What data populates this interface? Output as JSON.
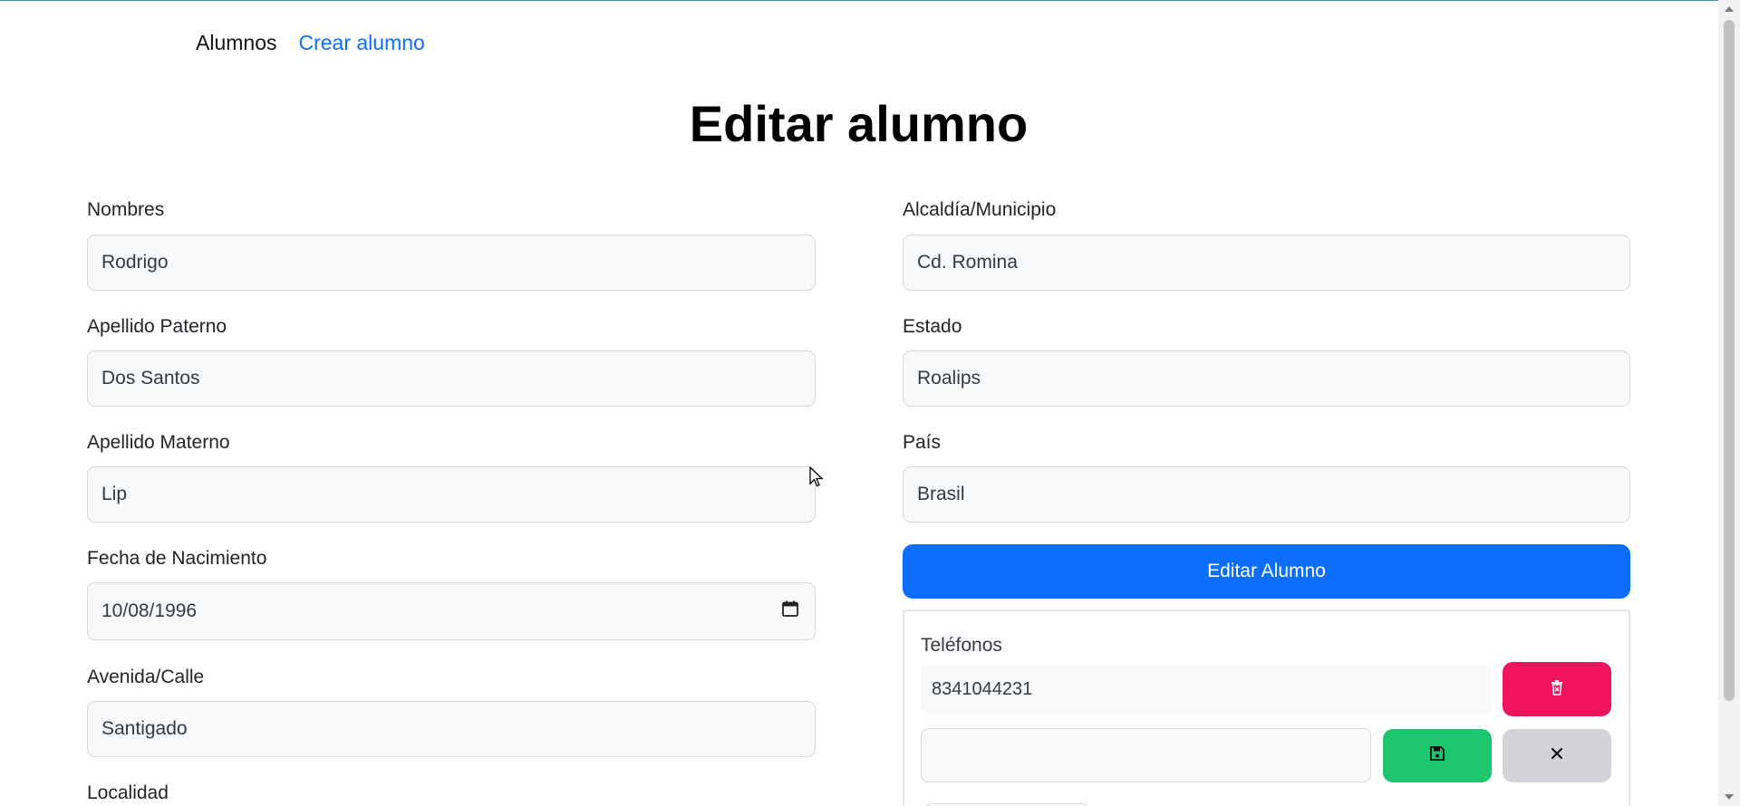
{
  "nav": {
    "brand": "Alumnos",
    "create_link": "Crear alumno"
  },
  "page_title": "Editar alumno",
  "form": {
    "nombres": {
      "label": "Nombres",
      "value": "Rodrigo"
    },
    "apellido_paterno": {
      "label": "Apellido Paterno",
      "value": "Dos Santos"
    },
    "apellido_materno": {
      "label": "Apellido Materno",
      "value": "Lip"
    },
    "fecha_nacimiento": {
      "label": "Fecha de Nacimiento",
      "value": "10/08/1996"
    },
    "avenida_calle": {
      "label": "Avenida/Calle",
      "value": "Santigado"
    },
    "localidad": {
      "label": "Localidad"
    },
    "alcaldia": {
      "label": "Alcaldía/Municipio",
      "value": "Cd. Romina"
    },
    "estado": {
      "label": "Estado",
      "value": "Roalips"
    },
    "pais": {
      "label": "País",
      "value": "Brasil"
    }
  },
  "submit_label": "Editar Alumno",
  "phones": {
    "title": "Teléfonos",
    "items": [
      "8341044231"
    ],
    "new_value": ""
  },
  "icons": {
    "delete": "trash-icon",
    "save": "save-icon",
    "cancel": "close-icon",
    "date": "calendar-icon"
  },
  "colors": {
    "primary": "#0d6efd",
    "danger": "#f0145c",
    "success": "#1dc56c",
    "secondary": "#d4d4d8"
  }
}
